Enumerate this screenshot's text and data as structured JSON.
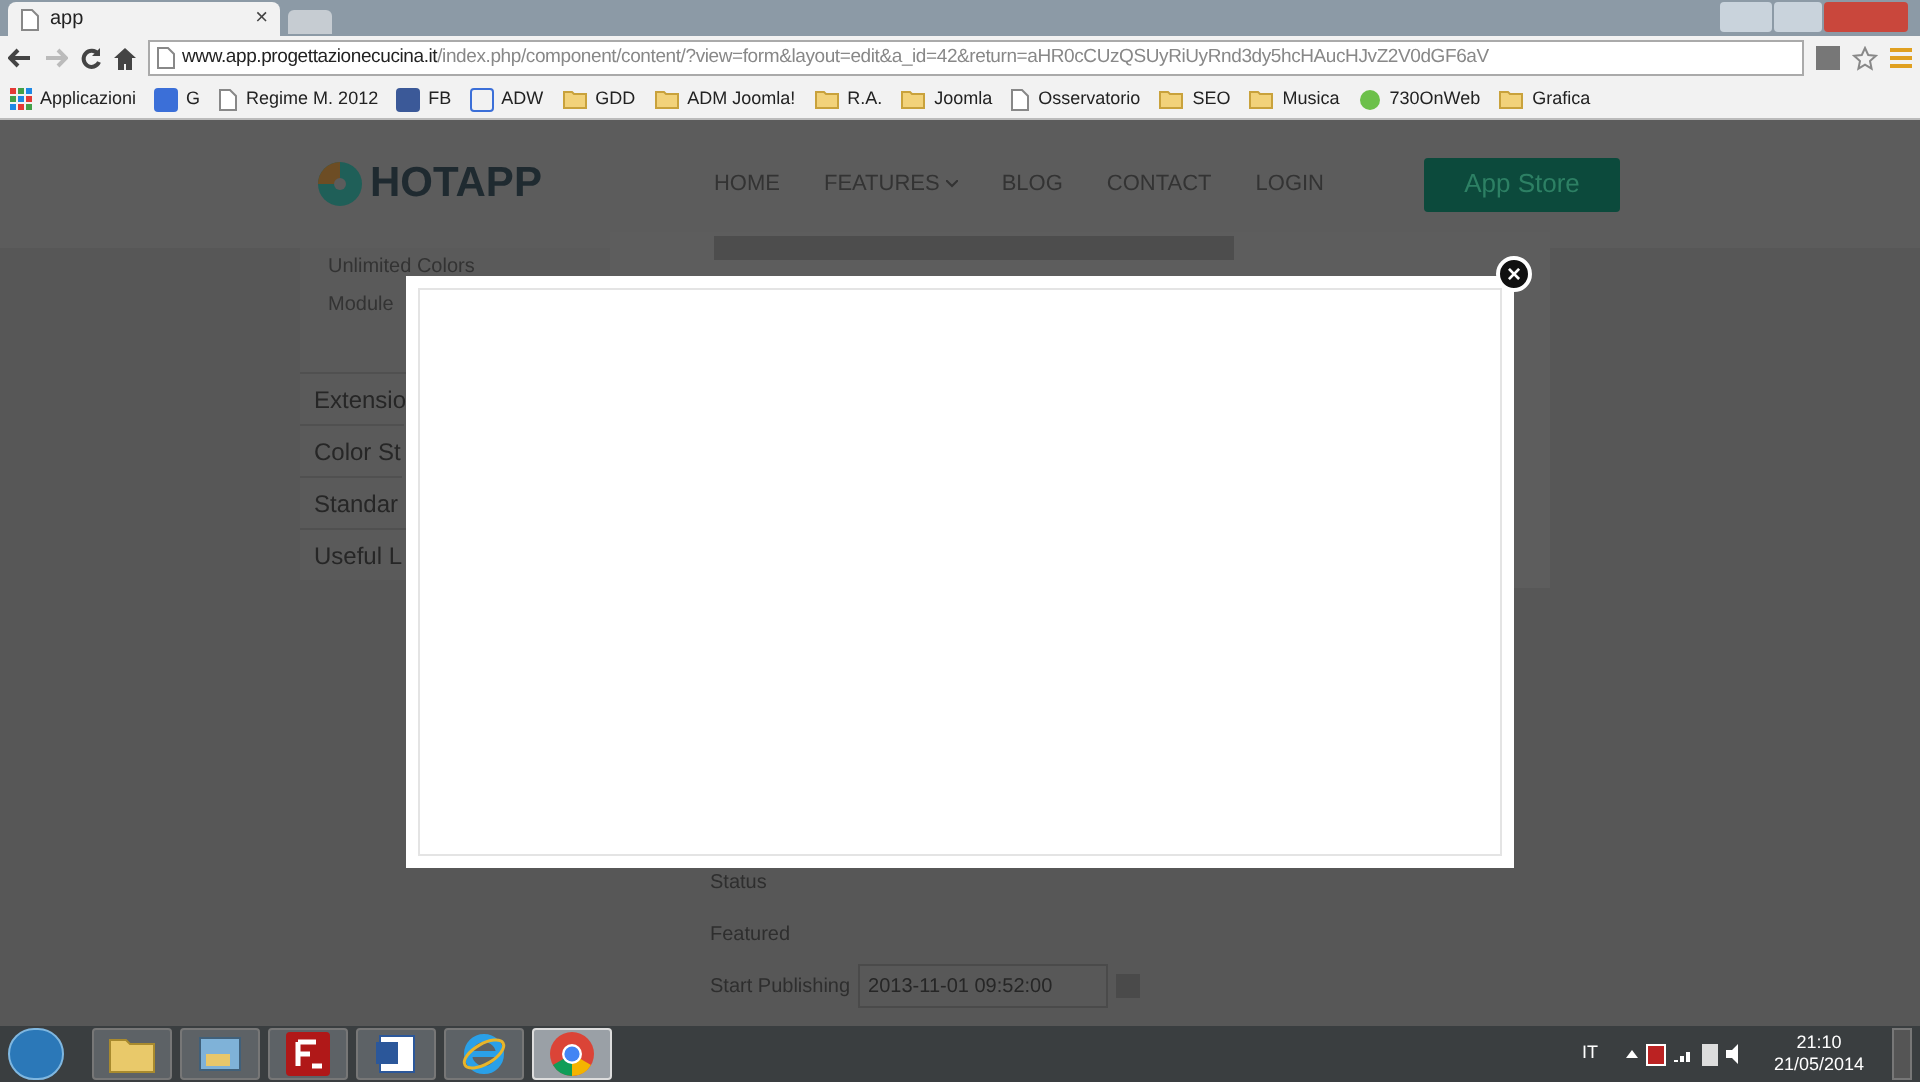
{
  "browser": {
    "tab": {
      "title": "app",
      "close": "×"
    },
    "url": {
      "host": "www.app.progettazionecucina.it",
      "path": "/index.php/component/content/?view=form&layout=edit&a_id=42&return=aHR0cCUzQSUyRiUyRnd3dy5hcHAucHJvZ2V0dGF6aV"
    },
    "bookmarks": [
      {
        "label": "Applicazioni",
        "kind": "apps"
      },
      {
        "label": "G",
        "kind": "google"
      },
      {
        "label": "Regime M. 2012",
        "kind": "page"
      },
      {
        "label": "FB",
        "kind": "facebook"
      },
      {
        "label": "ADW",
        "kind": "site"
      },
      {
        "label": "GDD",
        "kind": "folder"
      },
      {
        "label": "ADM Joomla!",
        "kind": "folder"
      },
      {
        "label": "R.A.",
        "kind": "folder"
      },
      {
        "label": "Joomla",
        "kind": "folder"
      },
      {
        "label": "Osservatorio",
        "kind": "page"
      },
      {
        "label": "SEO",
        "kind": "folder"
      },
      {
        "label": "Musica",
        "kind": "folder"
      },
      {
        "label": "730OnWeb",
        "kind": "leaf"
      },
      {
        "label": "Grafica",
        "kind": "folder"
      }
    ]
  },
  "site": {
    "logo": "HOTAPP",
    "nav": [
      {
        "label": "HOME",
        "dropdown": false
      },
      {
        "label": "FEATURES",
        "dropdown": true
      },
      {
        "label": "BLOG",
        "dropdown": false
      },
      {
        "label": "CONTACT",
        "dropdown": false
      },
      {
        "label": "LOGIN",
        "dropdown": false
      }
    ],
    "cta": "App Store",
    "sidebar_sub": [
      "Unlimited Colors",
      "Module"
    ],
    "sidebar": [
      "Extensio",
      "Color St",
      "Standar",
      "Useful L"
    ],
    "form": [
      {
        "label": "Status"
      },
      {
        "label": "Featured"
      },
      {
        "label": "Start Publishing",
        "value": "2013-11-01 09:52:00"
      }
    ]
  },
  "modal": {
    "close": "×"
  },
  "taskbar": {
    "apps": [
      {
        "kind": "explorer",
        "selected": false
      },
      {
        "kind": "media",
        "selected": false
      },
      {
        "kind": "filezilla",
        "selected": false
      },
      {
        "kind": "word",
        "selected": false
      },
      {
        "kind": "ie",
        "selected": false
      },
      {
        "kind": "chrome",
        "selected": true
      }
    ],
    "language": "IT",
    "time": "21:10",
    "date": "21/05/2014"
  }
}
